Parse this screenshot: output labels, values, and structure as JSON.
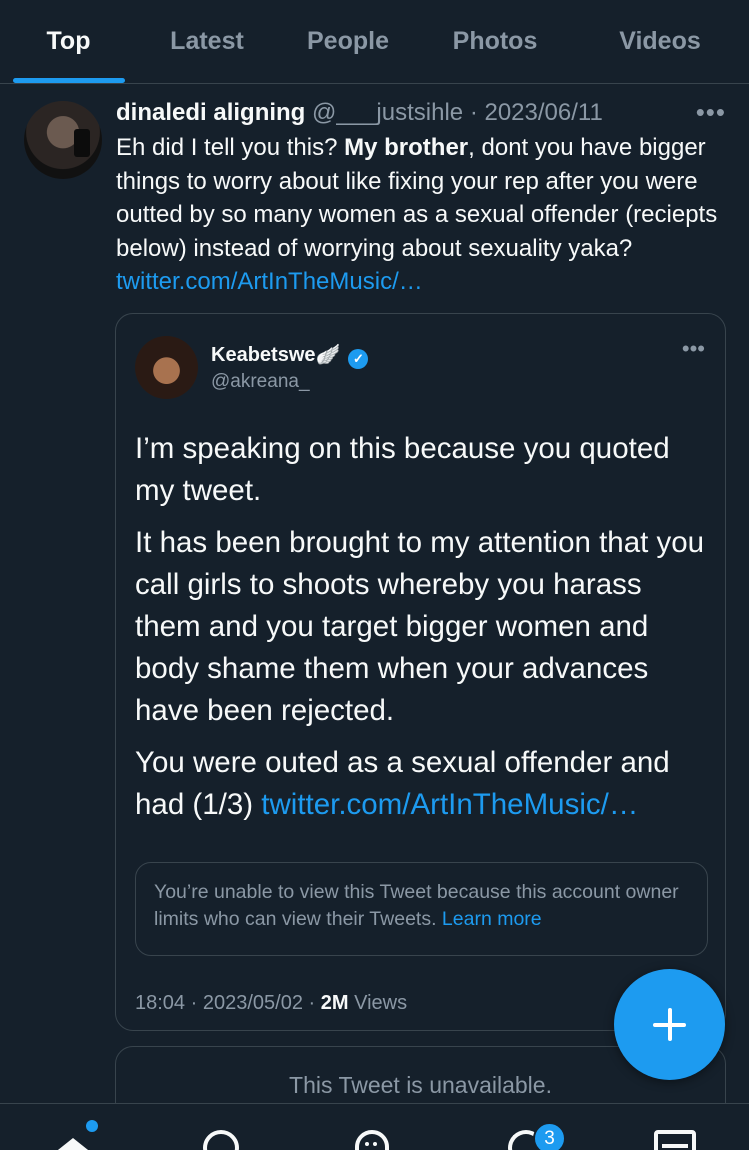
{
  "tabs": [
    {
      "label": "Top",
      "active": true
    },
    {
      "label": "Latest",
      "active": false
    },
    {
      "label": "People",
      "active": false
    },
    {
      "label": "Photos",
      "active": false
    },
    {
      "label": "Videos",
      "active": false
    }
  ],
  "tweet": {
    "author_name": "dinaledi aligning",
    "author_handle": "@___justsihle",
    "separator": "·",
    "date": "2023/06/11",
    "more": "•••",
    "text_part1": "Eh did I tell you this? ",
    "text_bold": "My brother",
    "text_part2": ", dont you have bigger things to worry about like fixing your rep after you were outted by so many women as a sexual offender (reciepts below) instead of worrying about sexuality yaka? ",
    "link": "twitter.com/ArtInTheMusic/…"
  },
  "quote": {
    "name": "Keabetswe",
    "name_emoji": "🪽",
    "handle": "@akreana_",
    "verified_mark": "✓",
    "more": "•••",
    "para1": "I’m speaking on this because you quoted my tweet.",
    "para2": "It has been brought to my attention that you call girls to shoots whereby you harass them and you target bigger women and body shame them when your advances have been rejected.",
    "para3": "You were outed as a sexual offender and had (1/3) ",
    "para3_link": "twitter.com/ArtInTheMusic/…",
    "notice_text": "You’re unable to view this Tweet because this account owner limits who can view their Tweets. ",
    "notice_link": "Learn more",
    "footer_time": "18:04",
    "footer_sep1": " · ",
    "footer_date": "2023/05/02",
    "footer_sep2": " · ",
    "footer_views_count": "2M",
    "footer_views_label": " Views"
  },
  "unavailable_text": "This Tweet is unavailable.",
  "notifications_badge": "3",
  "colors": {
    "background": "#15202b",
    "accent": "#1d9bf0",
    "secondary_text": "#8b98a5",
    "border": "#38444d"
  },
  "icons": [
    "home-icon",
    "search-icon",
    "spaces-icon",
    "notifications-icon",
    "messages-icon",
    "compose-plus-icon",
    "verified-badge-icon"
  ]
}
